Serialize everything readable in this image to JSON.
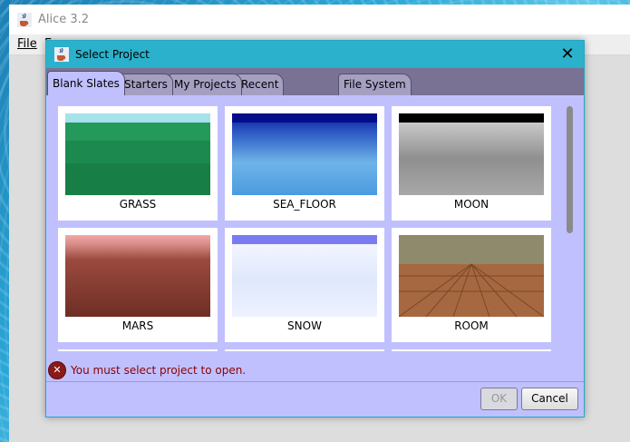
{
  "app": {
    "title": "Alice  3.2",
    "menu_file": "File",
    "menu_next": "E"
  },
  "dialog": {
    "title": "Select Project",
    "close_glyph": "✕",
    "tabs": [
      "Blank Slates",
      "Starters",
      "My Projects",
      "Recent",
      "File System"
    ],
    "selected_tab": "Blank Slates",
    "templates": [
      "GRASS",
      "SEA_FLOOR",
      "MOON",
      "MARS",
      "SNOW",
      "ROOM"
    ],
    "error": {
      "icon": "✕",
      "text": "You must select project to open."
    },
    "buttons": {
      "ok": "OK",
      "cancel": "Cancel"
    }
  },
  "colors": {
    "dialog_title": "#2bb1cb",
    "dialog_bg": "#c0c0ff",
    "tab_strip": "#7a7294",
    "error_text": "#8b0000"
  },
  "icons": {
    "app_icon": "java-cup-icon",
    "dialog_icon": "java-cup-icon",
    "error_icon": "error-circle-icon"
  }
}
